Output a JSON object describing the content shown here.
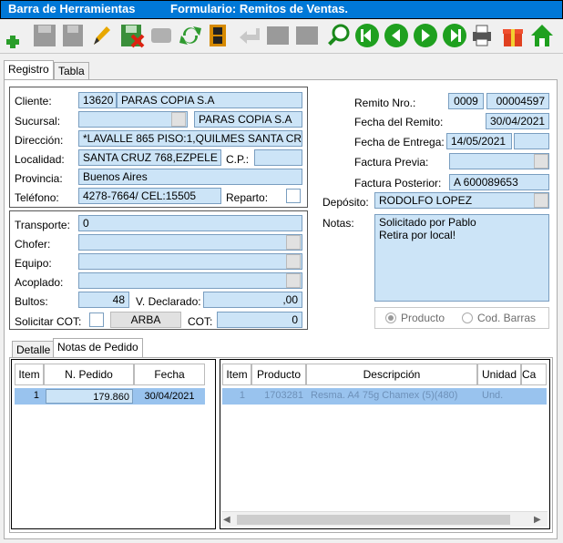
{
  "title": {
    "left": "Barra de Herramientas",
    "right": "Formulario: Remitos de Ventas."
  },
  "tabs": {
    "registro": "Registro",
    "tabla": "Tabla"
  },
  "cliente": {
    "cliente_label": "Cliente:",
    "cliente_code": "13620",
    "cliente_name": "PARAS COPIA S.A",
    "sucursal_label": "Sucursal:",
    "sucursal_code": "",
    "sucursal_name": "PARAS COPIA S.A",
    "direccion_label": "Dirección:",
    "direccion": "*LAVALLE 865 PISO:1,QUILMES SANTA CR",
    "localidad_label": "Localidad:",
    "localidad": "SANTA CRUZ 768,EZPELE",
    "cp_label": "C.P.:",
    "cp": "",
    "provincia_label": "Provincia:",
    "provincia": "Buenos Aires",
    "telefono_label": "Teléfono:",
    "telefono": "4278-7664/ CEL:15505",
    "reparto_label": "Reparto:"
  },
  "transporte": {
    "transporte_label": "Transporte:",
    "transporte": "0",
    "chofer_label": "Chofer:",
    "chofer": "",
    "equipo_label": "Equipo:",
    "equipo": "",
    "acoplado_label": "Acoplado:",
    "acoplado": "",
    "bultos_label": "Bultos:",
    "bultos": "48",
    "vdeclarado_label": "V. Declarado:",
    "vdeclarado": ",00",
    "solicitar_cot_label": "Solicitar COT:",
    "arba_label": "ARBA",
    "cot_label": "COT:",
    "cot": "0"
  },
  "remito": {
    "nro_label": "Remito Nro.:",
    "nro_prefix": "0009",
    "nro": "00004597",
    "fecha_label": "Fecha del Remito:",
    "fecha": "30/04/2021",
    "entrega_label": "Fecha de Entrega:",
    "entrega": "14/05/2021",
    "factura_previa_label": "Factura Previa:",
    "factura_previa": "",
    "factura_posterior_label": "Factura Posterior:",
    "factura_posterior": "A  600089653",
    "deposito_label": "Depósito:",
    "deposito": "RODOLFO LOPEZ",
    "notas_label": "Notas:",
    "notas_line1": "Solicitado por Pablo",
    "notas_line2": "Retira por local!",
    "radio_producto": "Producto",
    "radio_codbarras": "Cod. Barras"
  },
  "subtabs": {
    "detalle": "Detalle",
    "notas_pedido": "Notas de Pedido"
  },
  "pedidos": {
    "headers": [
      "Item",
      "N. Pedido",
      "Fecha"
    ],
    "rows": [
      {
        "item": "1",
        "pedido": "179.860",
        "fecha": "30/04/2021"
      }
    ]
  },
  "productos": {
    "headers": [
      "Item",
      "Producto",
      "Descripción",
      "Unidad",
      "Ca"
    ],
    "rows": [
      {
        "item": "1",
        "producto": "1703281",
        "descripcion": "Resma. A4 75g Chamex (5)(480)",
        "unidad": "Und."
      }
    ]
  },
  "colors": {
    "titlebar": "#0078d7",
    "field": "#cce4f7",
    "selected_row": "#99c3ee"
  }
}
